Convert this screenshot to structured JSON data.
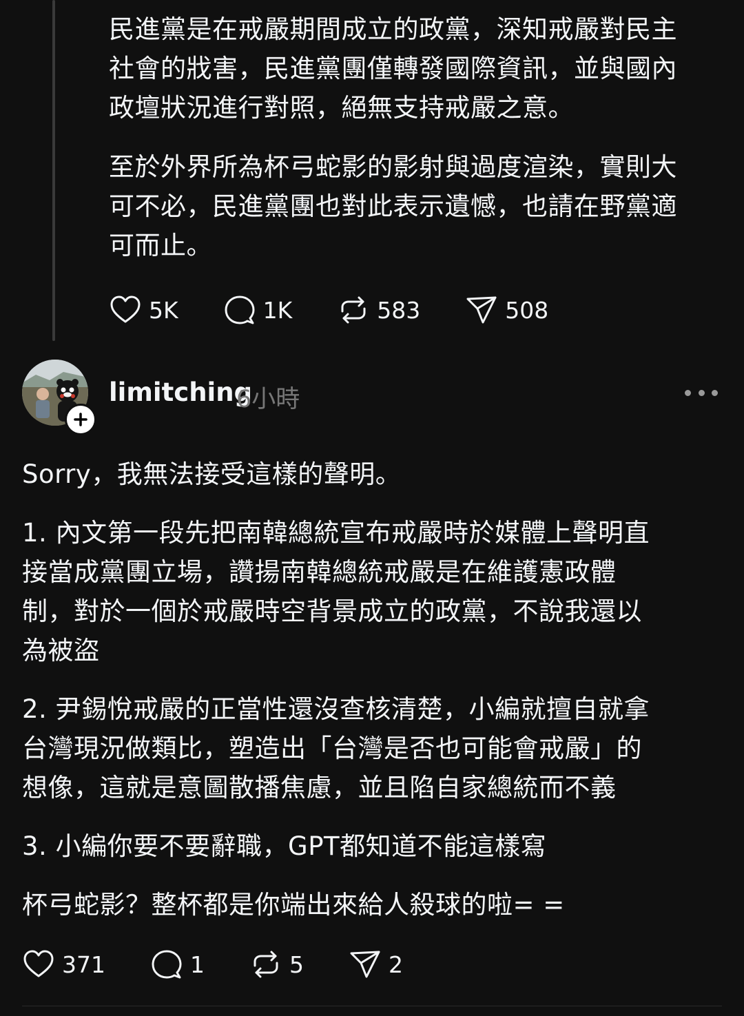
{
  "post1": {
    "paragraphs": [
      "民進黨是在戒嚴期間成立的政黨，深知戒嚴對民主\n社會的戕害，民進黨團僅轉發國際資訊，並與國內\n政壇狀況進行對照，絕無支持戒嚴之意。",
      "至於外界所為杯弓蛇影的影射與過度渲染，實則大\n可不必，民進黨團也對此表示遺憾，也請在野黨適\n可而止。"
    ],
    "actions": {
      "likes": "5K",
      "comments": "1K",
      "reposts": "583",
      "shares": "508"
    }
  },
  "post2": {
    "username": "limitching",
    "timestamp": "6小時",
    "paragraphs": [
      "Sorry，我無法接受這樣的聲明。",
      "1. 內文第一段先把南韓總統宣布戒嚴時於媒體上聲明直\n接當成黨團立場，讚揚南韓總統戒嚴是在維護憲政體\n制，對於一個於戒嚴時空背景成立的政黨，不說我還以\n為被盜",
      "2. 尹錫悅戒嚴的正當性還沒查核清楚，小編就擅自就拿\n台灣現況做類比，塑造出「台灣是否也可能會戒嚴」的\n想像，這就是意圖散播焦慮，並且陷自家總統而不義",
      "3. 小編你要不要辭職，GPT都知道不能這樣寫",
      "杯弓蛇影？整杯都是你端出來給人殺球的啦= ="
    ],
    "actions": {
      "likes": "371",
      "comments": "1",
      "reposts": "5",
      "shares": "2"
    }
  },
  "icons": {
    "like": "heart-icon",
    "comment": "speech-bubble-icon",
    "repost": "repost-arrows-icon",
    "share": "paper-plane-icon",
    "more": "more-options-icon",
    "follow": "plus-icon"
  },
  "colors": {
    "background": "#101010",
    "text": "#f3f5f7",
    "muted": "#777777",
    "thread_line": "#3a3a3a"
  }
}
